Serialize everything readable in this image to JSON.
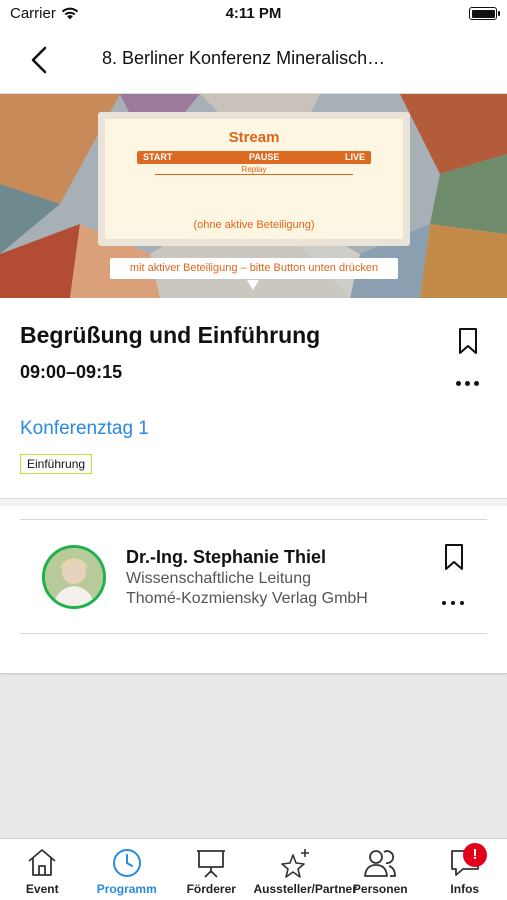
{
  "status_bar": {
    "carrier": "Carrier",
    "time": "4:11 PM"
  },
  "nav": {
    "title": "8. Berliner Konferenz Mineralisch…"
  },
  "banner": {
    "stream_title": "Stream",
    "controls": {
      "start": "START",
      "pause": "PAUSE",
      "live": "LIVE"
    },
    "replay": "Replay",
    "note": "(ohne aktive Beteiligung)",
    "cta": "mit aktiver Beteiligung – bitte Button unten drücken"
  },
  "session": {
    "title": "Begrüßung und Einführung",
    "time": "09:00–09:15",
    "day_link": "Konferenztag 1",
    "tag": "Einführung"
  },
  "speaker": {
    "name": "Dr.-Ing. Stephanie Thiel",
    "role": "Wissenschaftliche Leitung",
    "organization": "Thomé-Kozmiensky Verlag GmbH"
  },
  "tabs": [
    {
      "label": "Event",
      "icon": "home-icon"
    },
    {
      "label": "Programm",
      "icon": "clock-icon",
      "active": true
    },
    {
      "label": "Förderer",
      "icon": "presentation-board-icon"
    },
    {
      "label": "Aussteller/Partner",
      "icon": "stars-icon"
    },
    {
      "label": "Personen",
      "icon": "people-icon"
    },
    {
      "label": "Infos",
      "icon": "chat-bubble-icon",
      "badge": "!"
    }
  ],
  "colors": {
    "accent": "#2a8adf",
    "stream_orange": "#e0651b",
    "tag_border": "#c5e23c",
    "avatar_ring": "#1db34a",
    "badge_red": "#e3001b"
  }
}
